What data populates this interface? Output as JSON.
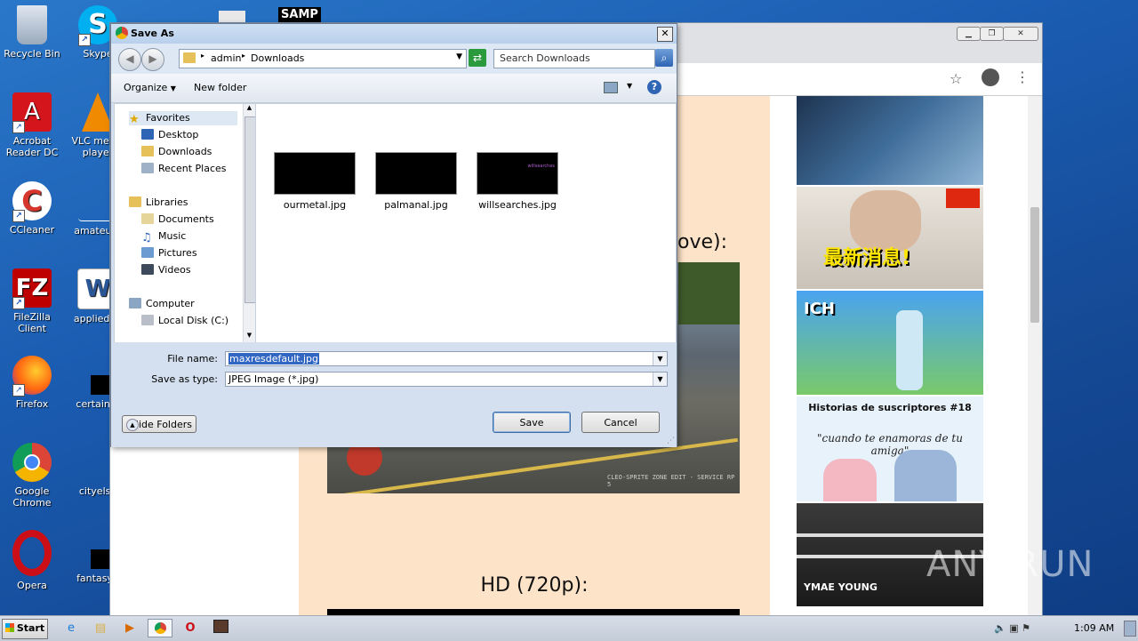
{
  "desktop": {
    "icons": [
      {
        "label": "Recycle Bin",
        "icon": "recycle-bin-icon",
        "color": "#b8c4d4"
      },
      {
        "label": "Skype",
        "icon": "skype-icon",
        "color": "#00aff0"
      },
      {
        "label": "Acrobat Reader DC",
        "icon": "acrobat-icon",
        "color": "#d4151c"
      },
      {
        "label": "VLC media player",
        "icon": "vlc-icon",
        "color": "#f08a00"
      },
      {
        "label": "CCleaner",
        "icon": "ccleaner-icon",
        "color": "#d7362c"
      },
      {
        "label": "amateurn",
        "icon": "file-icon",
        "color": "#ffffff"
      },
      {
        "label": "FileZilla Client",
        "icon": "filezilla-icon",
        "color": "#bf0000"
      },
      {
        "label": "appliedag",
        "icon": "word-icon",
        "color": "#2b5797"
      },
      {
        "label": "Firefox",
        "icon": "firefox-icon",
        "color": "#ff6611"
      },
      {
        "label": "certainm",
        "icon": "black-file-icon",
        "color": "#000000"
      },
      {
        "label": "Google Chrome",
        "icon": "chrome-icon",
        "color": "#4285f4"
      },
      {
        "label": "cityelse",
        "icon": "file-icon",
        "color": "#ffffff"
      },
      {
        "label": "Opera",
        "icon": "opera-icon",
        "color": "#cc0f16"
      },
      {
        "label": "fantasyu",
        "icon": "black-file-icon",
        "color": "#000000"
      }
    ],
    "top_partial_labels": [
      "SAMP"
    ]
  },
  "chrome_page": {
    "heading_partial": "ove):",
    "heading_hd": "HD (720p):",
    "game_caption": "CLEO-SPRITE ZONE EDIT - SERVICE RP 5",
    "sidebar_thumbs": [
      {
        "title": "",
        "color": "#1e3350"
      },
      {
        "title": "最新消息!",
        "color": "#e7e2da"
      },
      {
        "title": "ICH",
        "color": "#3d8de0"
      },
      {
        "title": "Historias de suscriptores #18",
        "subtitle": "\"cuando te enamoras de tu amiga\"",
        "color": "#e8f2fb"
      },
      {
        "title": "YMAE YOUNG",
        "color": "#2a2a2a"
      }
    ],
    "watermark": "ANY RUN"
  },
  "dialog": {
    "title": "Save As",
    "close_label": "✕",
    "path": [
      "admin",
      "Downloads"
    ],
    "search_placeholder": "Search Downloads",
    "organize_label": "Organize",
    "new_folder_label": "New folder",
    "nav": {
      "favorites": "Favorites",
      "favorites_items": [
        "Desktop",
        "Downloads",
        "Recent Places"
      ],
      "libraries": "Libraries",
      "libraries_items": [
        "Documents",
        "Music",
        "Pictures",
        "Videos"
      ],
      "computer": "Computer",
      "computer_items": [
        "Local Disk (C:)"
      ]
    },
    "files": [
      {
        "name": "ourmetal.jpg",
        "overlay": ""
      },
      {
        "name": "palmanal.jpg",
        "overlay": ""
      },
      {
        "name": "willsearches.jpg",
        "overlay": "willsearches"
      }
    ],
    "file_name_label": "File name:",
    "file_name_value": "maxresdefault.jpg",
    "save_type_label": "Save as type:",
    "save_type_value": "JPEG Image (*.jpg)",
    "save_label": "Save",
    "cancel_label": "Cancel",
    "hide_folders_label": "Hide Folders"
  },
  "taskbar": {
    "start_label": "Start",
    "time": "1:09 AM"
  }
}
